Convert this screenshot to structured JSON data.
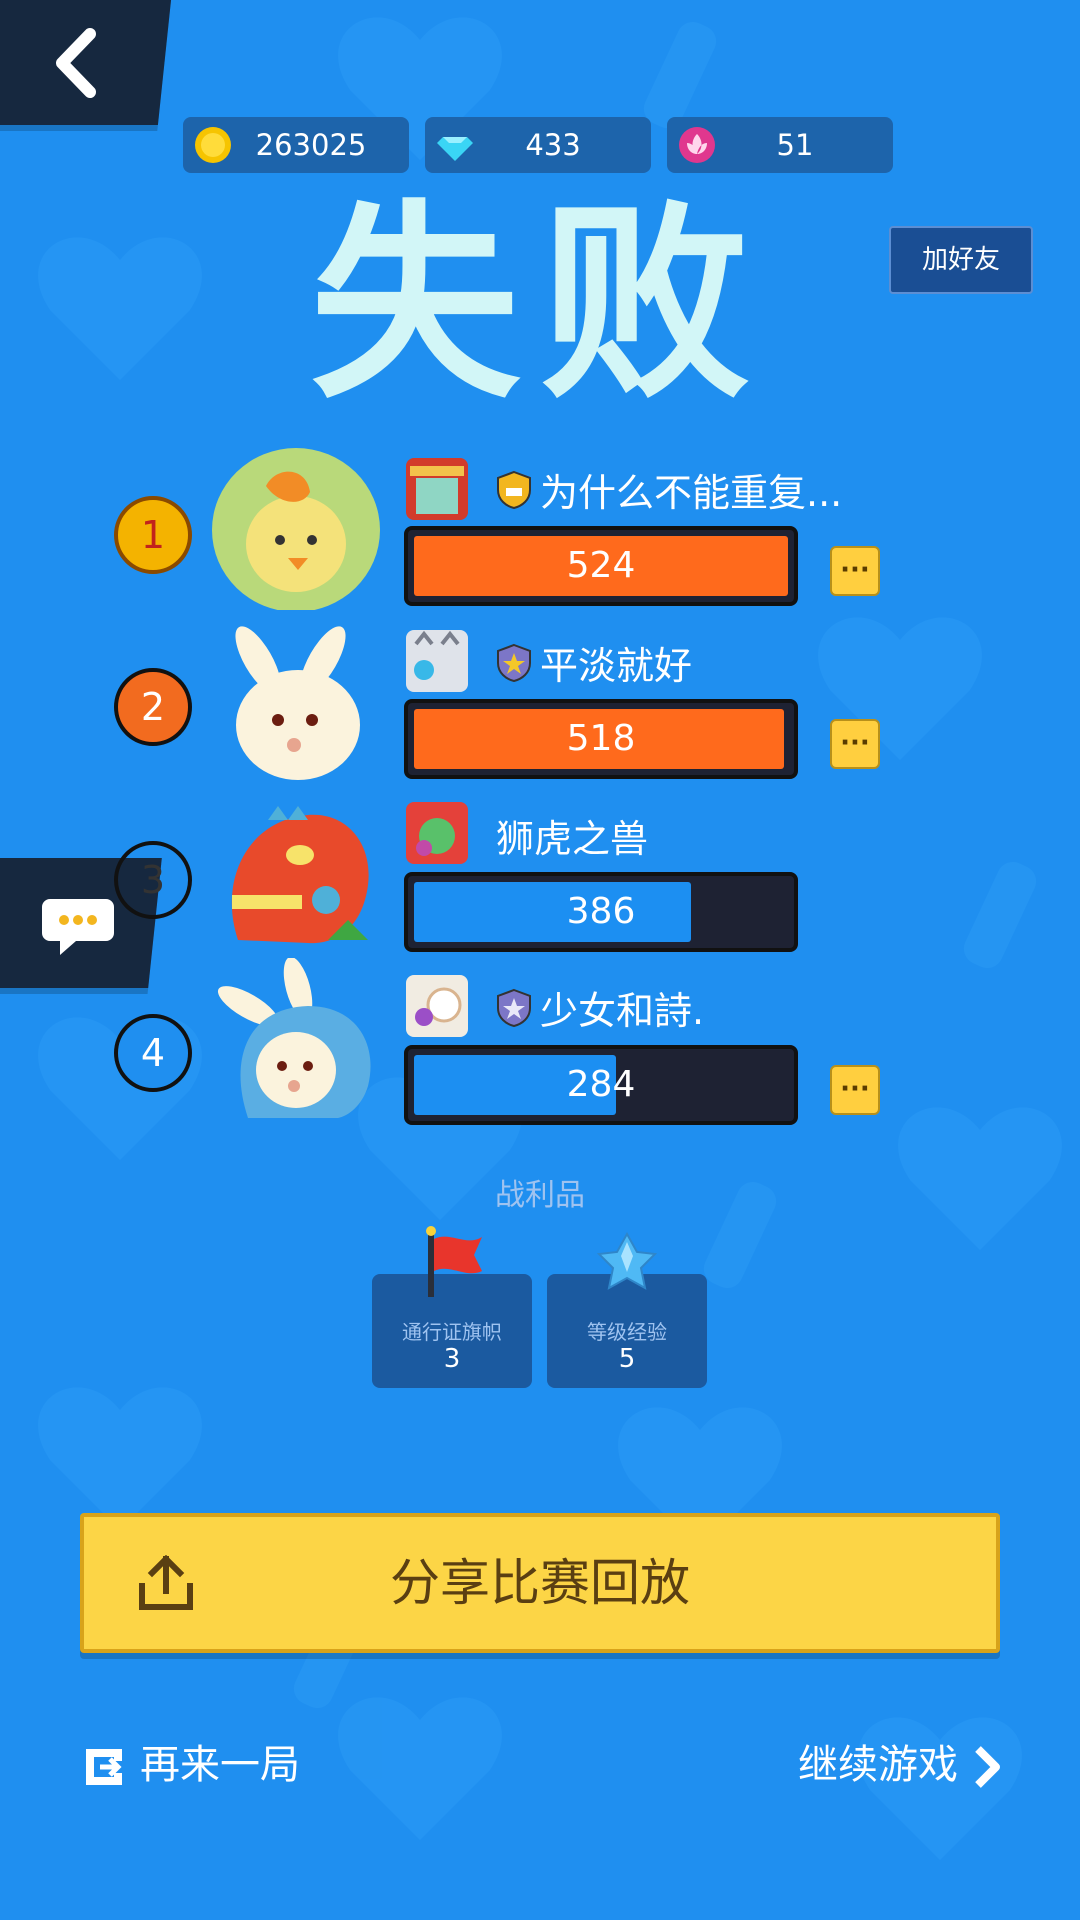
{
  "currency": {
    "coins": "263025",
    "diamonds": "433",
    "lotus": "51"
  },
  "result_title": "失败",
  "add_friend_label": "加好友",
  "players": [
    {
      "rank": "1",
      "name": "为什么不能重复...",
      "score": "524",
      "progress": 1.0,
      "bar_color": "#ff6a1c",
      "badge_color": "#f4b300",
      "shield": "gold"
    },
    {
      "rank": "2",
      "name": "平淡就好",
      "score": "518",
      "progress": 0.99,
      "bar_color": "#ff6a1c",
      "badge_color": "#f26b1f",
      "shield": "purple"
    },
    {
      "rank": "3",
      "name": "狮虎之兽",
      "score": "386",
      "progress": 0.74,
      "bar_color": "#1c8ff2",
      "badge_color": "#1f8ff0",
      "shield": "none"
    },
    {
      "rank": "4",
      "name": "少女和詩.",
      "score": "284",
      "progress": 0.54,
      "bar_color": "#1c8ff2",
      "badge_color": "#1f8ff0",
      "shield": "purple"
    }
  ],
  "more_label": "···",
  "loot": {
    "title": "战利品",
    "items": [
      {
        "name": "通行证旗帜",
        "count": "3"
      },
      {
        "name": "等级经验",
        "count": "5"
      }
    ]
  },
  "share_button_label": "分享比赛回放",
  "replay_label": "再来一局",
  "continue_label": "继续游戏",
  "colors": {
    "background": "#1f8ff0",
    "title": "#d2f6f7",
    "share_button": "#fcd546"
  }
}
